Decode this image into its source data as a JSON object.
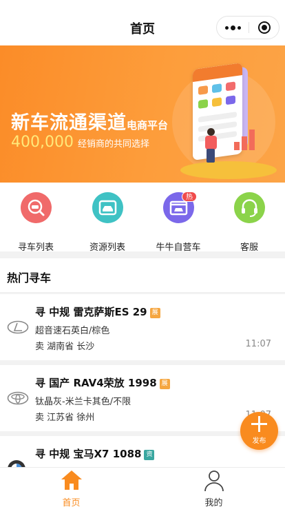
{
  "navbar": {
    "title": "首页"
  },
  "banner": {
    "title": "新车流通渠道",
    "title_suffix": "电商平台",
    "count": "400,000",
    "count_desc": "经销商的共同选择"
  },
  "quick_menu": [
    {
      "label": "寻车列表",
      "icon": "car-search-icon",
      "color": "#f06a6a"
    },
    {
      "label": "资源列表",
      "icon": "car-resource-icon",
      "color": "#3fc2c4"
    },
    {
      "label": "牛牛自营车",
      "icon": "shop-car-icon",
      "color": "#7b68ea",
      "badge": "热"
    },
    {
      "label": "客服",
      "icon": "headset-icon",
      "color": "#8bd34a"
    }
  ],
  "hot_section": {
    "title": "热门寻车"
  },
  "listings": [
    {
      "brand_icon": "lexus-logo-icon",
      "prefix": "寻",
      "title": "中规 雷克萨斯ES 29",
      "tag": "展",
      "tag_color": "#f5a640",
      "sub": "超音速石英白/棕色",
      "location": "卖 湖南省 长沙",
      "time": "11:07"
    },
    {
      "brand_icon": "toyota-logo-icon",
      "prefix": "寻",
      "title": "国产 RAV4荣放 1998",
      "tag": "展",
      "tag_color": "#f5a640",
      "sub": "钛晶灰-米兰卡其色/不限",
      "location": "卖 江苏省 徐州",
      "time": "11:07"
    },
    {
      "brand_icon": "bmw-logo-icon",
      "prefix": "寻",
      "title": "中规 宝马X7 1088",
      "tag": "资",
      "tag_color": "#3aa7a0",
      "sub": "",
      "location": "",
      "time": ""
    }
  ],
  "fab": {
    "label": "发布"
  },
  "tabbar": {
    "active_color": "#f98b1f",
    "items": [
      {
        "label": "首页",
        "icon": "home-icon",
        "active": true
      },
      {
        "label": "我的",
        "icon": "user-icon",
        "active": false
      }
    ]
  }
}
